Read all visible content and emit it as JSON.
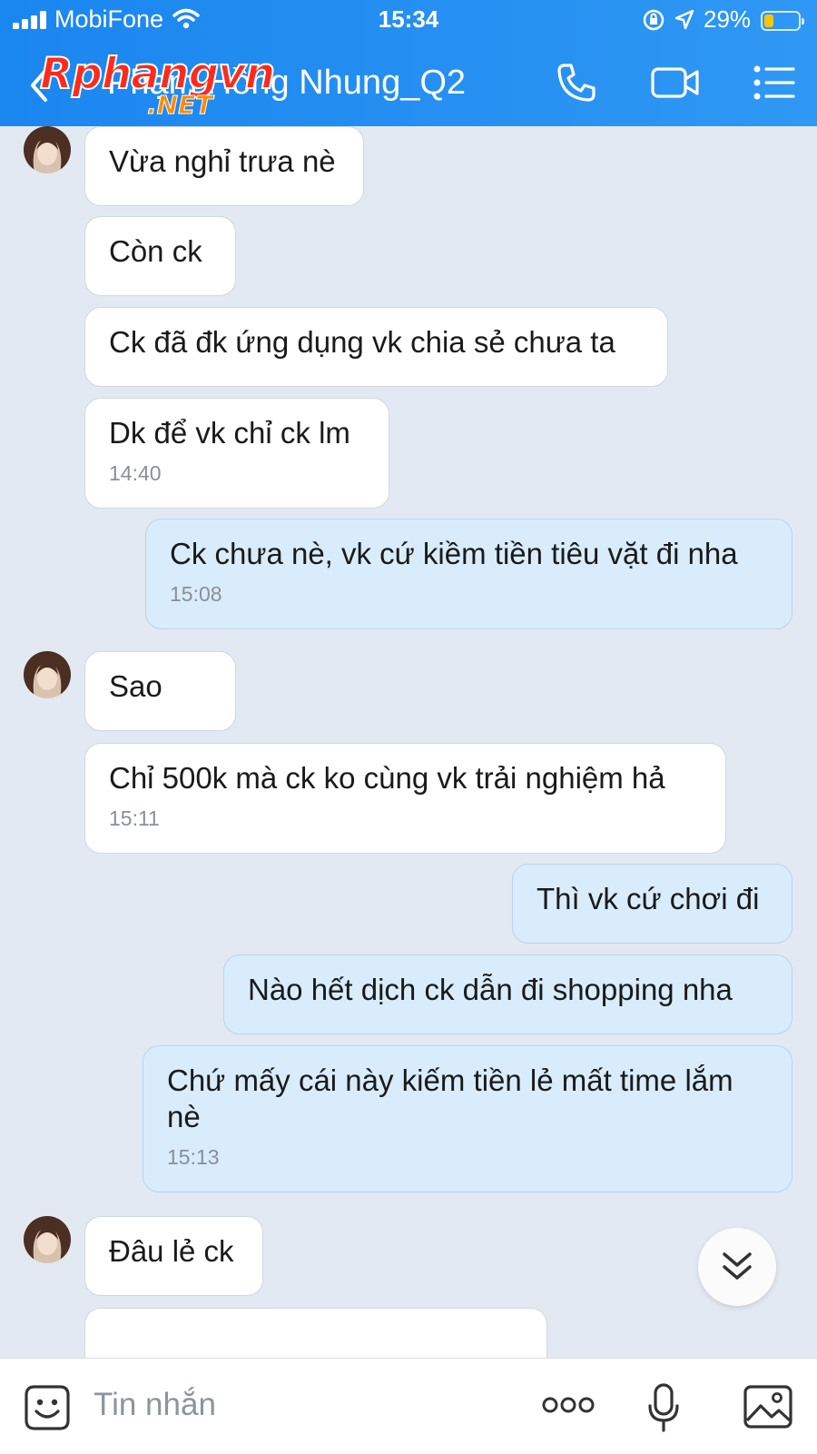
{
  "status_bar": {
    "carrier": "MobiFone",
    "time": "15:34",
    "battery": "29%",
    "battery_level": 0.29
  },
  "header": {
    "title": "Phạm Hồng Nhung_Q2",
    "watermark_main": "Rphangvn",
    "watermark_sub": ".NET"
  },
  "messages": [
    {
      "dir": "in",
      "text": "Vừa nghỉ trưa nè",
      "time": ""
    },
    {
      "dir": "in",
      "text": "Còn ck",
      "time": ""
    },
    {
      "dir": "in",
      "text": "Ck đã đk ứng dụng vk chia sẻ chưa ta",
      "time": ""
    },
    {
      "dir": "in",
      "text": "Dk để vk chỉ ck lm",
      "time": "14:40"
    },
    {
      "dir": "out",
      "text": "Ck chưa nè, vk cứ kiềm tiền tiêu vặt đi nha",
      "time": "15:08"
    },
    {
      "dir": "in",
      "text": "Sao",
      "time": ""
    },
    {
      "dir": "in",
      "text": "Chỉ 500k mà ck ko cùng vk trải nghiệm hả",
      "time": "15:11"
    },
    {
      "dir": "out",
      "text": "Thì vk cứ chơi đi",
      "time": ""
    },
    {
      "dir": "out",
      "text": "Nào hết dịch ck dẫn đi shopping nha",
      "time": ""
    },
    {
      "dir": "out",
      "text": "Chứ mấy cái này kiếm tiền lẻ mất time lắm nè",
      "time": "15:13"
    },
    {
      "dir": "in",
      "text": "Đâu lẻ ck",
      "time": ""
    },
    {
      "dir": "in",
      "text": "",
      "time": ""
    }
  ],
  "composer": {
    "placeholder": "Tin nhắn"
  },
  "icons": {
    "back": "back-chevron-icon",
    "call": "phone-icon",
    "video": "video-camera-icon",
    "menu": "list-menu-icon",
    "sticker": "sticker-icon",
    "more": "more-dots-icon",
    "mic": "microphone-icon",
    "image": "image-icon",
    "scroll": "double-chevron-down-icon"
  },
  "colors": {
    "header": "#2f98f4",
    "incoming_bubble": "#ffffff",
    "outgoing_bubble": "#d8ecfc",
    "background": "#e2e9f2"
  }
}
